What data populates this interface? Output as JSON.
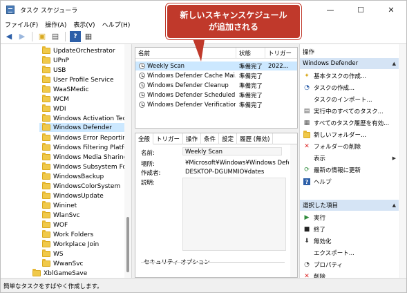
{
  "window": {
    "title": "タスク スケジューラ",
    "minimize": "—",
    "maximize": "☐",
    "close": "✕"
  },
  "menu": [
    "ファイル(F)",
    "操作(A)",
    "表示(V)",
    "ヘルプ(H)"
  ],
  "toolbar": {
    "icons": [
      "back-icon",
      "forward-icon",
      "folder-up-icon",
      "pane-icon",
      "help-icon",
      "properties-icon"
    ]
  },
  "tree": {
    "items": [
      {
        "label": "UpdateOrchestrator"
      },
      {
        "label": "UPnP"
      },
      {
        "label": "USB"
      },
      {
        "label": "User Profile Service"
      },
      {
        "label": "WaaSMedic"
      },
      {
        "label": "WCM"
      },
      {
        "label": "WDI"
      },
      {
        "label": "Windows Activation Tech"
      },
      {
        "label": "Windows Defender",
        "selected": true
      },
      {
        "label": "Windows Error Reporting"
      },
      {
        "label": "Windows Filtering Platfo"
      },
      {
        "label": "Windows Media Sharing"
      },
      {
        "label": "Windows Subsystem For"
      },
      {
        "label": "WindowsBackup"
      },
      {
        "label": "WindowsColorSystem"
      },
      {
        "label": "WindowsUpdate"
      },
      {
        "label": "Wininet"
      },
      {
        "label": "WlanSvc"
      },
      {
        "label": "WOF"
      },
      {
        "label": "Work Folders"
      },
      {
        "label": "Workplace Join"
      },
      {
        "label": "WS"
      },
      {
        "label": "WwanSvc"
      },
      {
        "label": "XblGameSave"
      }
    ]
  },
  "task_list": {
    "columns": [
      "名前",
      "状態",
      "トリガー"
    ],
    "rows": [
      {
        "name": "Weekly Scan",
        "status": "準備完了",
        "trigger": "2022...",
        "selected": true
      },
      {
        "name": "Windows Defender Cache Mai...",
        "status": "準備完了",
        "trigger": ""
      },
      {
        "name": "Windows Defender Cleanup",
        "status": "準備完了",
        "trigger": ""
      },
      {
        "name": "Windows Defender Scheduled...",
        "status": "準備完了",
        "trigger": ""
      },
      {
        "name": "Windows Defender Verification",
        "status": "準備完了",
        "trigger": ""
      }
    ]
  },
  "detail": {
    "tabs": [
      "全般",
      "トリガー",
      "操作",
      "条件",
      "設定",
      "履歴 (無効)"
    ],
    "name_label": "名前:",
    "name_value": "Weekly Scan",
    "location_label": "場所:",
    "location_value": "¥Microsoft¥Windows¥Windows Defend",
    "author_label": "作成者:",
    "author_value": "DESKTOP-DGUMMIO¥dates",
    "description_label": "説明:",
    "security_label": "セキュリティ オプション"
  },
  "actions": {
    "header": "操作",
    "group1": "Windows Defender",
    "items1": [
      {
        "label": "基本タスクの作成...",
        "icon": "create-basic-task-icon"
      },
      {
        "label": "タスクの作成...",
        "icon": "create-task-icon"
      },
      {
        "label": "タスクのインポート...",
        "icon": ""
      },
      {
        "label": "実行中のすべてのタスク...",
        "icon": "running-tasks-icon"
      },
      {
        "label": "すべてのタスク履歴を有効...",
        "icon": "history-icon"
      },
      {
        "label": "新しいフォルダー...",
        "icon": "new-folder-icon"
      },
      {
        "label": "フォルダーの削除",
        "icon": "delete-icon"
      },
      {
        "label": "表示",
        "icon": "",
        "submenu": true
      },
      {
        "label": "最新の情報に更新",
        "icon": "refresh-icon"
      },
      {
        "label": "ヘルプ",
        "icon": "help-icon"
      }
    ],
    "group2": "選択した項目",
    "items2": [
      {
        "label": "実行",
        "icon": "run-icon"
      },
      {
        "label": "終了",
        "icon": "stop-icon"
      },
      {
        "label": "無効化",
        "icon": "disable-icon"
      },
      {
        "label": "エクスポート...",
        "icon": ""
      },
      {
        "label": "プロパティ",
        "icon": "properties-icon"
      },
      {
        "label": "削除",
        "icon": "delete-icon"
      }
    ]
  },
  "status": "簡単なタスクをすばやく作成します。",
  "callout": {
    "line1": "新しいスキャンスケジュール",
    "line2": "が追加される",
    "color": "#c0392b"
  }
}
